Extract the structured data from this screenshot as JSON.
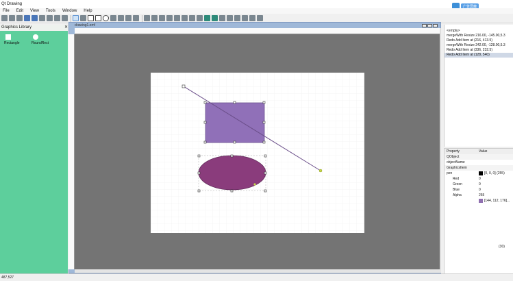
{
  "window": {
    "title": "Qt Drawing"
  },
  "badge": {
    "label": "广告屏蔽"
  },
  "menu": [
    "File",
    "Edit",
    "View",
    "Tools",
    "Window",
    "Help"
  ],
  "library": {
    "title": "Graphics Library",
    "items": [
      {
        "label": "Rectangle"
      },
      {
        "label": "RoundRect"
      }
    ]
  },
  "document": {
    "title": "drawing1.emf"
  },
  "undo": {
    "items": [
      "<empty>",
      "mergeWith Resize   216.00, -145.00,5.3",
      "Redo Add Item at (216, 413.5)",
      "mergeWith Resize   242.00, -128.00,5.3",
      "Redo Add Item at (336, 232.5)",
      "Redo Add Item at (128, 540)"
    ],
    "selected_index": 5
  },
  "properties": {
    "col_property": "Property",
    "col_value": "Value",
    "rows": [
      {
        "k": "QObject",
        "v": "",
        "type": "grp"
      },
      {
        "k": "objectName",
        "v": "",
        "type": "row"
      },
      {
        "k": "GraphicsItem",
        "v": "",
        "type": "grp"
      },
      {
        "k": "pen",
        "v": "[0, 0, 0] (255)",
        "type": "row",
        "swatch": "#000000"
      },
      {
        "k": "Red",
        "v": "0",
        "type": "row"
      },
      {
        "k": "Green",
        "v": "0",
        "type": "row"
      },
      {
        "k": "Blue",
        "v": "0",
        "type": "row"
      },
      {
        "k": "Alpha",
        "v": "255",
        "type": "row"
      },
      {
        "k": "",
        "v": "[144, 112, 176]...",
        "type": "row",
        "swatch": "#9070b0"
      }
    ]
  },
  "page_button": "(30)",
  "status": "487,527",
  "colors": {
    "library_bg": "#5dcf9c",
    "canvas_bg": "#747474",
    "rect_fill": "#9070b8",
    "ellipse_fill": "#8a3c7c",
    "line": "#6b4f8a"
  }
}
